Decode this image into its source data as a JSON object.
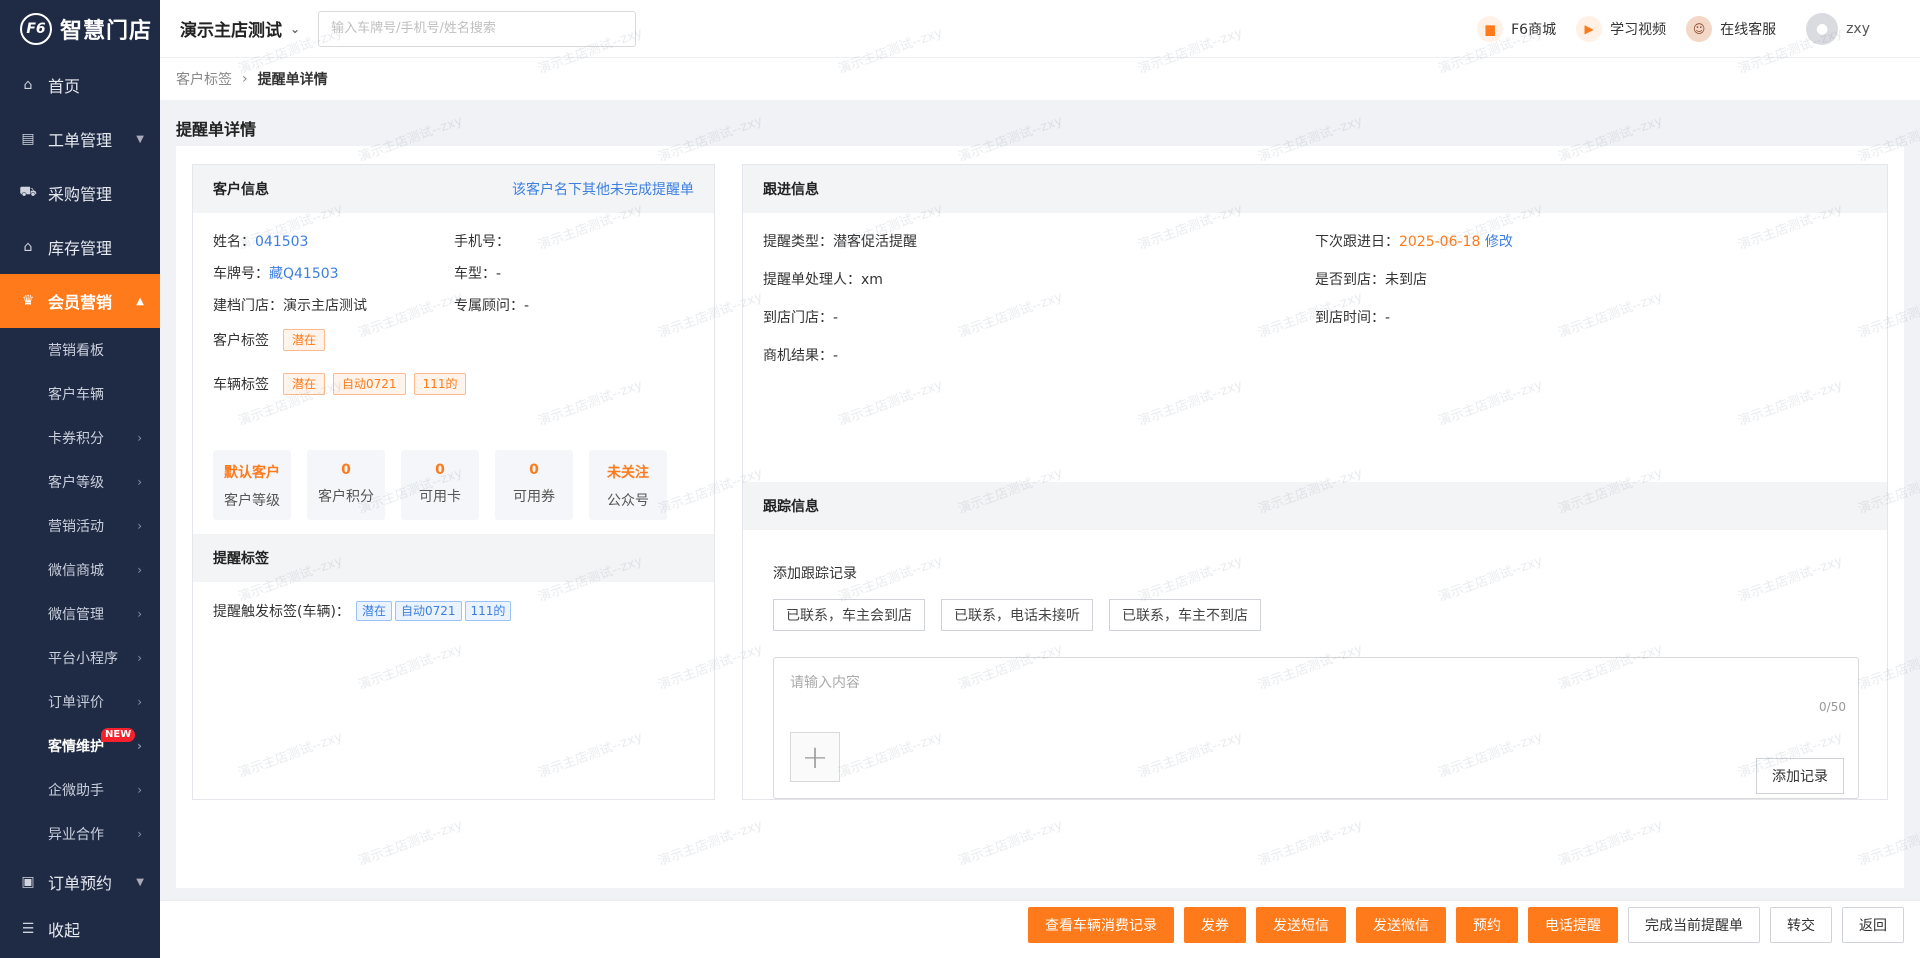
{
  "app": {
    "logo_text": "智慧门店",
    "logo_mark": "F6"
  },
  "topbar": {
    "store_name": "演示主店测试",
    "search_placeholder": "输入车牌号/手机号/姓名搜索",
    "mall": "F6商城",
    "video": "学习视频",
    "service": "在线客服",
    "user": "zxy"
  },
  "sidebar": {
    "items": [
      {
        "label": "首页",
        "icon": "home-icon"
      },
      {
        "label": "工单管理",
        "icon": "order-icon"
      },
      {
        "label": "采购管理",
        "icon": "cart-icon"
      },
      {
        "label": "库存管理",
        "icon": "warehouse-icon"
      },
      {
        "label": "会员营销",
        "icon": "crown-icon"
      }
    ],
    "sub_items": [
      "营销看板",
      "客户车辆",
      "卡券积分",
      "客户等级",
      "营销活动",
      "微信商城",
      "微信管理",
      "平台小程序",
      "订单评价",
      "客情维护",
      "企微助手",
      "异业合作"
    ],
    "new_badge": "NEW",
    "bottom_items": [
      {
        "label": "订单预约",
        "icon": "clipboard-icon"
      },
      {
        "label": "收起",
        "icon": "collapse-icon"
      }
    ]
  },
  "breadcrumb": {
    "parent": "客户标签",
    "current": "提醒单详情"
  },
  "page_title": "提醒单详情",
  "customer": {
    "header": "客户信息",
    "link": "该客户名下其他未完成提醒单",
    "name_label": "姓名：",
    "name": "041503",
    "phone_label": "手机号：",
    "phone": "",
    "plate_label": "车牌号：",
    "plate": "藏Q41503",
    "model_label": "车型：",
    "model": "-",
    "store_label": "建档门店：",
    "store": "演示主店测试",
    "advisor_label": "专属顾问：",
    "advisor": "-",
    "customer_tag_label": "客户标签",
    "customer_tags": [
      "潜在"
    ],
    "vehicle_tag_label": "车辆标签",
    "vehicle_tags": [
      "潜在",
      "自动0721",
      "111的"
    ],
    "stats": [
      {
        "value": "默认客户",
        "label": "客户等级"
      },
      {
        "value": "0",
        "label": "客户积分"
      },
      {
        "value": "0",
        "label": "可用卡"
      },
      {
        "value": "0",
        "label": "可用券"
      },
      {
        "value": "未关注",
        "label": "公众号"
      }
    ]
  },
  "reminder_tags": {
    "header": "提醒标签",
    "trigger_label": "提醒触发标签(车辆)：",
    "tags": [
      "潜在",
      "自动0721",
      "111的"
    ]
  },
  "follow": {
    "header": "跟进信息",
    "type_label": "提醒类型：",
    "type": "潜客促活提醒",
    "next_label": "下次跟进日：",
    "next_date": "2025-06-18",
    "modify": "修改",
    "handler_label": "提醒单处理人：",
    "handler": "xm",
    "arrived_label": "是否到店：",
    "arrived": "未到店",
    "arrive_store_label": "到店门店：",
    "arrive_store": "-",
    "arrive_time_label": "到店时间：",
    "arrive_time": "-",
    "result_label": "商机结果：",
    "result": "-"
  },
  "tracking": {
    "header": "跟踪信息",
    "add_label": "添加跟踪记录",
    "quick_buttons": [
      "已联系，车主会到店",
      "已联系，电话未接听",
      "已联系，车主不到店"
    ],
    "placeholder": "请输入内容",
    "counter": "0/50",
    "add_button": "添加记录"
  },
  "footer": {
    "buttons": [
      "查看车辆消费记录",
      "发券",
      "发送短信",
      "发送微信",
      "预约",
      "电话提醒",
      "完成当前提醒单",
      "转交",
      "返回"
    ]
  },
  "watermark": "演示主店测试--zxy"
}
